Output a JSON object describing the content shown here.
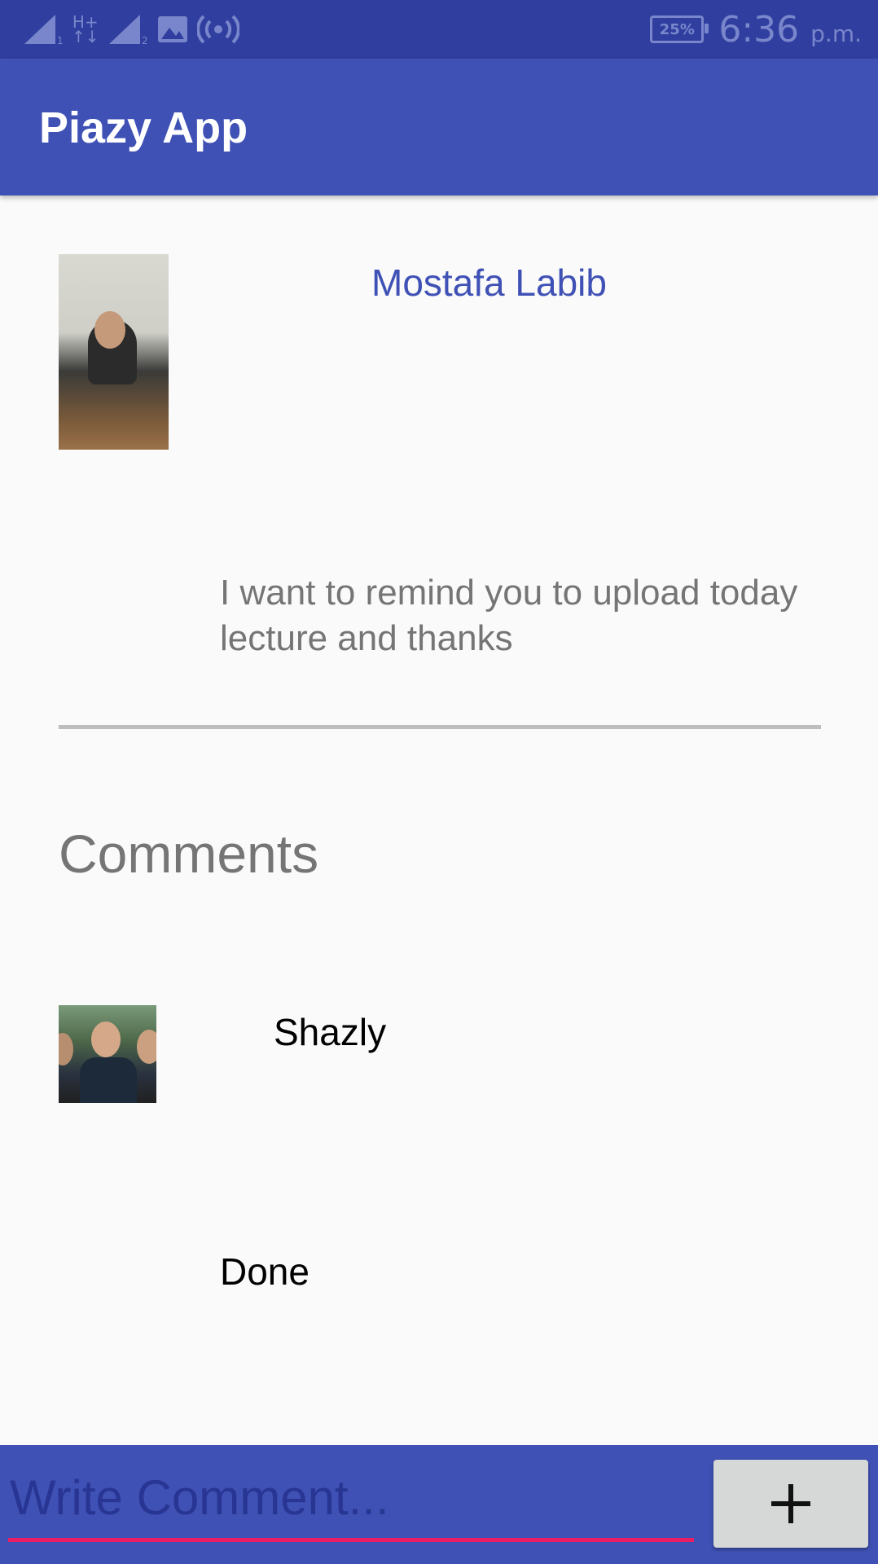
{
  "status_bar": {
    "network_left": "H+",
    "battery_percent": "25%",
    "time": "6:36",
    "time_suffix": "p.m.",
    "colors": {
      "background": "#303f9f",
      "icons": "#7986cb"
    }
  },
  "app_bar": {
    "title": "Piazy App",
    "color": "#3f51b5"
  },
  "post": {
    "author": "Mostafa Labib",
    "body": "I want to remind you to upload today lecture and thanks"
  },
  "comments_section": {
    "heading": "Comments",
    "items": [
      {
        "author": "Shazly",
        "body": "Done"
      }
    ]
  },
  "composer": {
    "placeholder": "Write Comment...",
    "value": "",
    "add_icon": "plus-icon",
    "accent": "#e91e63"
  }
}
